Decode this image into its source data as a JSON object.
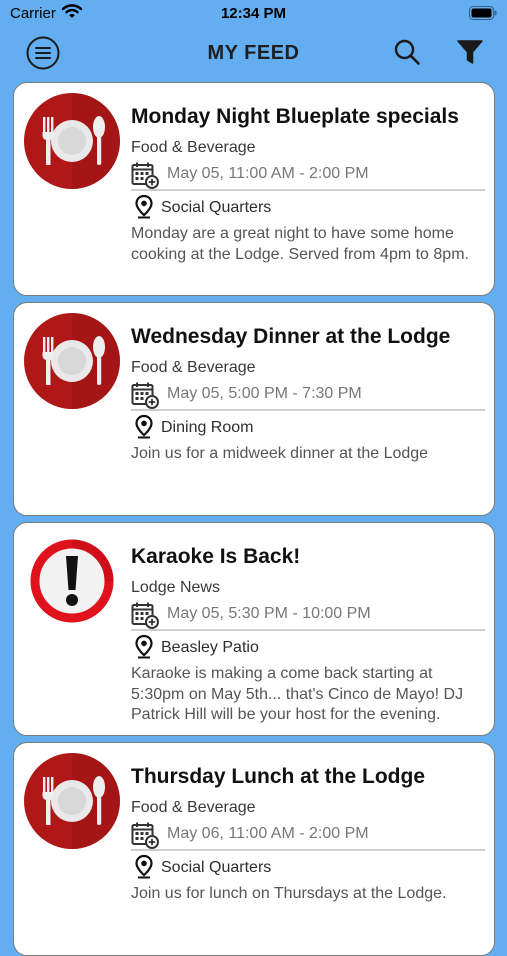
{
  "status_bar": {
    "carrier": "Carrier",
    "time": "12:34 PM"
  },
  "nav": {
    "title": "MY FEED"
  },
  "feed": [
    {
      "icon": "dining-plate-icon",
      "title": "Monday Night Blueplate specials",
      "category": "Food & Beverage",
      "datetime": "May 05, 11:00 AM - 2:00 PM",
      "location": "Social Quarters",
      "description": "Monday are a great night to have some home cooking at the Lodge.   Served from 4pm to 8pm."
    },
    {
      "icon": "dining-plate-icon",
      "title": "Wednesday Dinner at the Lodge",
      "category": "Food & Beverage",
      "datetime": "May 05, 5:00 PM - 7:30 PM",
      "location": "Dining Room",
      "description": "Join us for a midweek dinner at the Lodge"
    },
    {
      "icon": "alert-icon",
      "title": "Karaoke Is Back!",
      "category": "Lodge News",
      "datetime": "May 05, 5:30 PM - 10:00 PM",
      "location": "Beasley Patio",
      "description": "Karaoke is making a come back starting at 5:30pm on May 5th... that's Cinco de Mayo! DJ Patrick Hill will be your host for the evening."
    },
    {
      "icon": "dining-plate-icon",
      "title": "Thursday Lunch at the Lodge",
      "category": "Food & Beverage",
      "datetime": "May 06, 11:00 AM - 2:00 PM",
      "location": "Social Quarters",
      "description": "Join us for lunch on Thursdays at the Lodge."
    }
  ],
  "colors": {
    "background": "#62aef0",
    "plate_red": "#b01818",
    "alert_red": "#e0121b"
  }
}
